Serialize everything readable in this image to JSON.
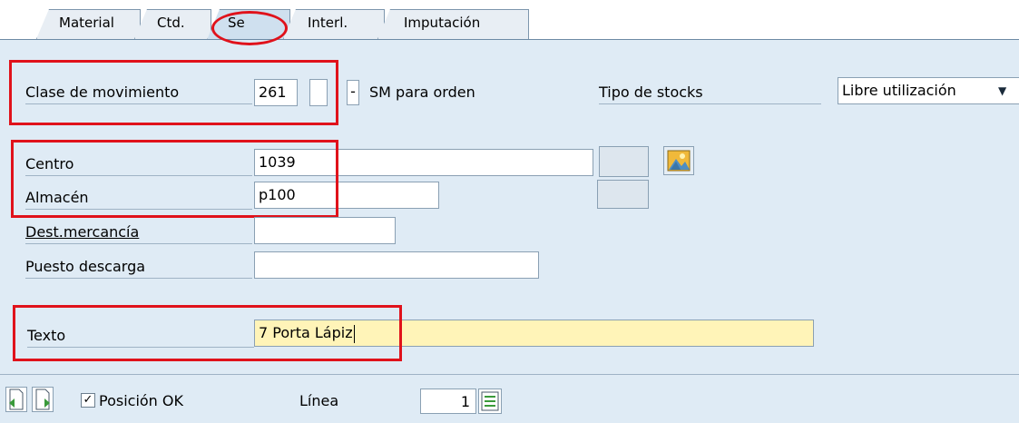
{
  "tabs": [
    {
      "label": "Material"
    },
    {
      "label": "Ctd."
    },
    {
      "label": "Se"
    },
    {
      "label": "Interl."
    },
    {
      "label": "Imputación"
    }
  ],
  "form": {
    "clase_label": "Clase de movimiento",
    "clase_value": "261",
    "clase_extra": "",
    "clase_dash": "-",
    "clase_desc": "SM para orden",
    "tipo_label": "Tipo de stocks",
    "tipo_value": "Libre utilización",
    "centro_label": "Centro",
    "centro_value": "1039",
    "almacen_label": "Almacén",
    "almacen_value": "p100",
    "dest_label": "Dest.mercancía",
    "dest_value": "",
    "puesto_label": "Puesto descarga",
    "puesto_value": "",
    "texto_label": "Texto",
    "texto_value": "7 Porta Lápiz"
  },
  "footer": {
    "posicion_label": "Posición OK",
    "posicion_checked": true,
    "linea_label": "Línea",
    "linea_value": "1"
  },
  "colors": {
    "annotation_red": "#e0121b",
    "background": "#dfebf5",
    "highlight_field": "#fff4b8"
  },
  "icons": [
    "mountain-picture-icon",
    "next-item-icon",
    "previous-item-icon",
    "item-detail-icon",
    "dropdown-arrow-icon",
    "checkbox-checked-icon"
  ]
}
